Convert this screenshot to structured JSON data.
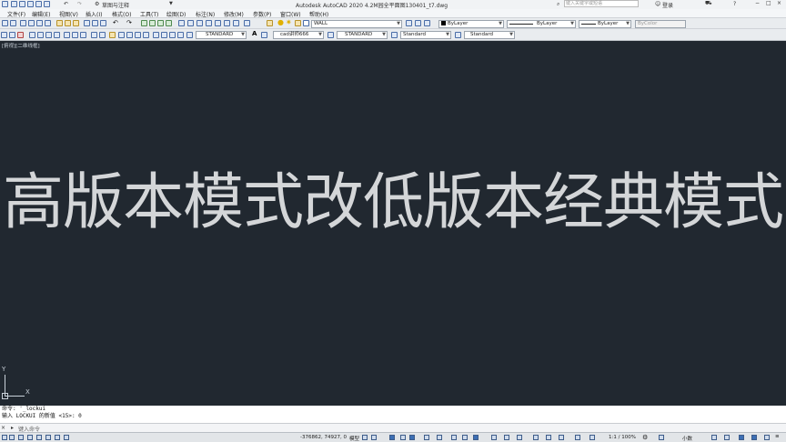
{
  "titlebar": {
    "workspace": "草图与注释",
    "title": "Autodesk AutoCAD 2020    4.2M园全平面图130401_t7.dwg",
    "search_placeholder": "键入关键字或短语",
    "login": "登录"
  },
  "menu": [
    "文件(F)",
    "编辑(E)",
    "视图(V)",
    "插入(I)",
    "格式(O)",
    "工具(T)",
    "绘图(D)",
    "标注(N)",
    "修改(M)",
    "参数(P)",
    "窗口(W)",
    "帮助(H)"
  ],
  "toolbar1": {
    "layer": "WALL",
    "color": "ByLayer",
    "linetype": "ByLayer",
    "lineweight": "ByLayer",
    "plotstyle": "ByColor"
  },
  "toolbar2": {
    "text_style": "STANDARD",
    "dim_style": "cad讲师666",
    "table_style": "STANDARD",
    "mleader_style": "Standard",
    "visual_style": "Standard"
  },
  "viewport_label": "[俯视][二维线框]",
  "canvas_text": "高版本模式改低版本经典模式",
  "ucs": {
    "y": "Y",
    "x": "X"
  },
  "command_history": [
    "命令: '_lockui",
    "输入 LOCKUI 的新值 <15>: 0"
  ],
  "command_prompt": "键入命令",
  "status": {
    "coords": "-376862, 74927, 0",
    "model": "模型",
    "scale": "1:1 / 100%",
    "units": "小数"
  },
  "colors": {
    "canvas": "#212830",
    "accent": "#3d6fb4"
  }
}
